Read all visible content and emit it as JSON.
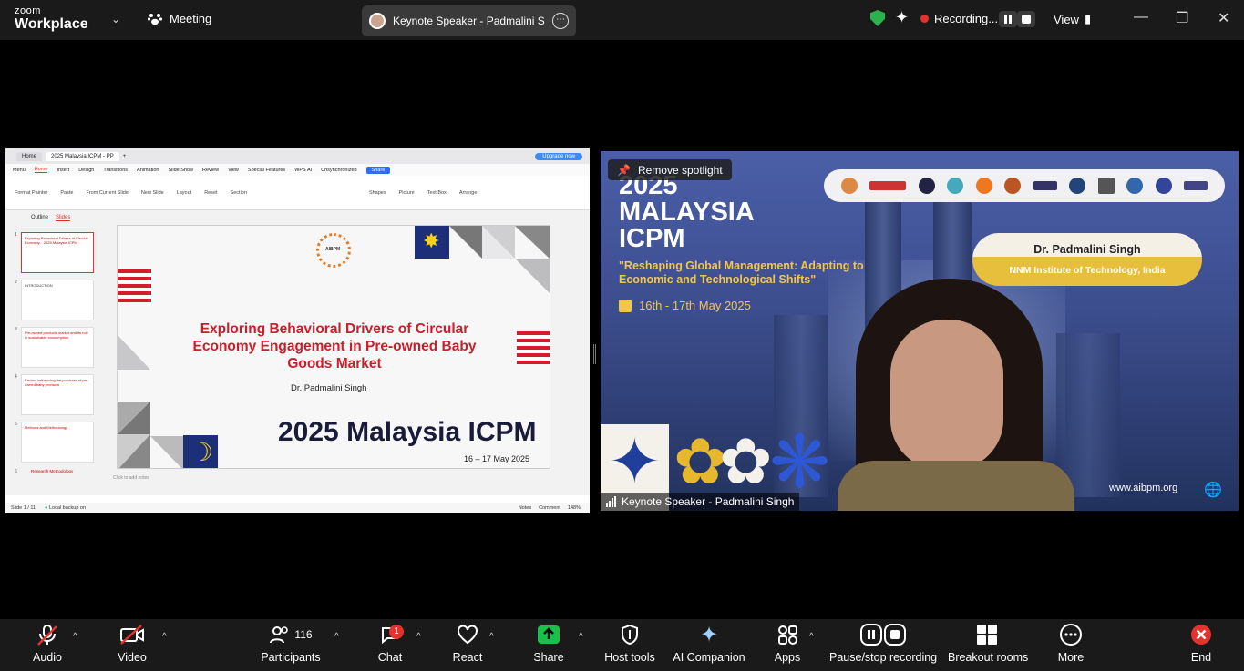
{
  "topbar": {
    "brand_top": "zoom",
    "brand_bottom": "Workplace",
    "meeting_label": "Meeting",
    "speaker_pill": "Keynote Speaker - Padmalini Singh",
    "recording_label": "Recording...",
    "view_label": "View"
  },
  "share": {
    "tabs": [
      "Home",
      "2025 Malaysia ICPM - PP"
    ],
    "upgrade_label": "Upgrade now",
    "menu": [
      "Menu",
      "Home",
      "Insert",
      "Design",
      "Transitions",
      "Animation",
      "Slide Show",
      "Review",
      "View",
      "Special Features",
      "WPS AI",
      "Unsynchronized"
    ],
    "share_button": "Share",
    "ribbon": [
      "Format Painter",
      "Paste",
      "From Current Slide",
      "New Slide",
      "Layout",
      "Reset",
      "Section",
      "Shapes",
      "Picture",
      "Text Box",
      "Arrange"
    ],
    "panel_tabs": [
      "Outline",
      "Slides"
    ],
    "thumbs": [
      {
        "num": "1",
        "text": "Exploring Behavioral Drivers of Circular Economy... 2025 Malaysia ICPM"
      },
      {
        "num": "2",
        "text": "INTRODUCTION"
      },
      {
        "num": "3",
        "text": "Pre-owned products market and its role in sustainable consumption"
      },
      {
        "num": "4",
        "text": "Factors influencing the purchase of pre-owned baby products"
      },
      {
        "num": "5",
        "text": "Methods and Methodology"
      }
    ],
    "thumb6": "Research Methodology",
    "slide": {
      "logo_text": "AIBPM",
      "title": "Exploring Behavioral Drivers of Circular Economy Engagement in Pre-owned Baby Goods Market",
      "author": "Dr. Padmalini Singh",
      "event": "2025 Malaysia ICPM",
      "dates": "16 – 17 May 2025"
    },
    "notes_placeholder": "Click to add notes",
    "status_left": "Slide 1 / 11",
    "status_backup": "Local backup on",
    "status_notes": "Notes",
    "status_comment": "Comment",
    "zoom_level": "148%"
  },
  "video": {
    "spotlight_label": "Remove spotlight",
    "title_line1": "2025",
    "title_line2": "MALAYSIA",
    "title_line3": "ICPM",
    "subtitle": "\"Reshaping Global Management: Adapting to Economic and Technological Shifts\"",
    "dates": "16th - 17th May 2025",
    "name": "Dr. Padmalini Singh",
    "institute": "NNM Institute of Technology, India",
    "url": "www.aibpm.org",
    "participant_label": "Keynote Speaker - Padmalini Singh"
  },
  "toolbar": {
    "audio": "Audio",
    "video": "Video",
    "participants": "Participants",
    "participants_count": "116",
    "chat": "Chat",
    "chat_badge": "1",
    "react": "React",
    "share": "Share",
    "host_tools": "Host tools",
    "ai_companion": "AI Companion",
    "apps": "Apps",
    "pause_stop": "Pause/stop recording",
    "breakout": "Breakout rooms",
    "more": "More",
    "end": "End"
  },
  "colors": {
    "accent_green": "#2bb24c",
    "share_green": "#1bc04a",
    "end_red": "#e5322d",
    "slide_red": "#c81f2a"
  }
}
